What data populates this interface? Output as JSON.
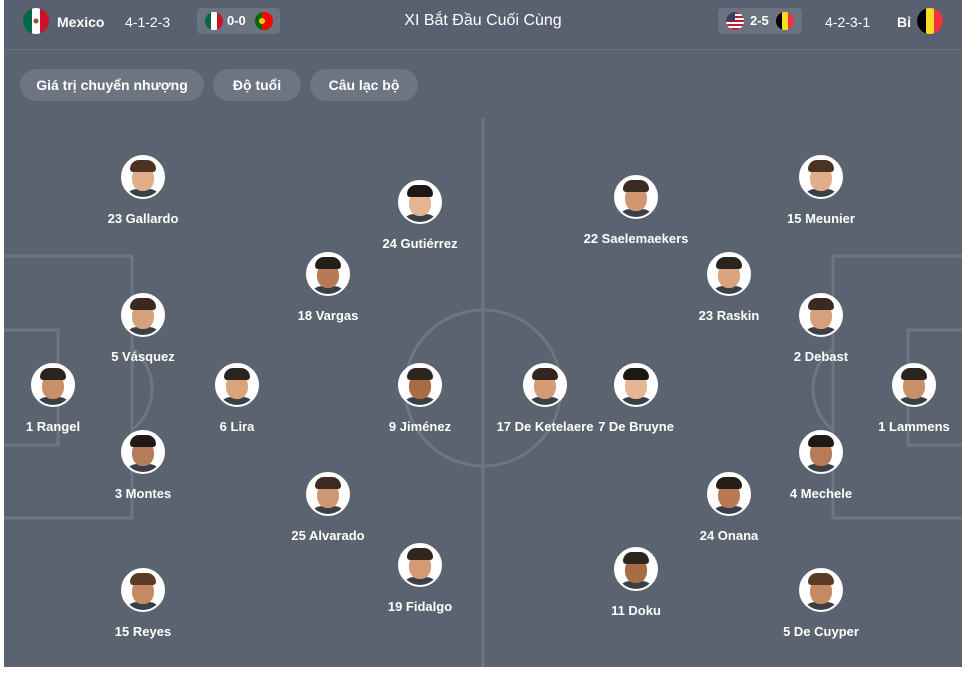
{
  "header": {
    "home_team": "Mexico",
    "home_formation": "4-1-2-3",
    "home_last_score": "0-0",
    "title": "XI Bắt Đầu Cuối Cùng",
    "away_last_score": "2-5",
    "away_formation": "4-2-3-1",
    "away_team": "Bỉ"
  },
  "filters": [
    "Giá trị chuyển nhượng",
    "Độ tuổi",
    "Câu lạc bộ"
  ],
  "colors": {
    "background": "#5b6370",
    "chip": "#6d7582",
    "pitch_lines": "#6e7684",
    "text": "#ffffff"
  },
  "home_players": [
    {
      "label": "1 Rangel"
    },
    {
      "label": "5 Vásquez"
    },
    {
      "label": "3 Montes"
    },
    {
      "label": "23 Gallardo"
    },
    {
      "label": "15 Reyes"
    },
    {
      "label": "6 Lira"
    },
    {
      "label": "18 Vargas"
    },
    {
      "label": "25 Alvarado"
    },
    {
      "label": "24 Gutiérrez"
    },
    {
      "label": "9 Jiménez"
    },
    {
      "label": "19 Fidalgo"
    }
  ],
  "away_players": [
    {
      "label": "1 Lammens"
    },
    {
      "label": "2 Debast"
    },
    {
      "label": "4 Mechele"
    },
    {
      "label": "15 Meunier"
    },
    {
      "label": "5 De Cuyper"
    },
    {
      "label": "23 Raskin"
    },
    {
      "label": "24 Onana"
    },
    {
      "label": "22 Saelemaekers"
    },
    {
      "label": "7 De Bruyne"
    },
    {
      "label": "11 Doku"
    },
    {
      "label": "17 De Ketelaere"
    }
  ]
}
